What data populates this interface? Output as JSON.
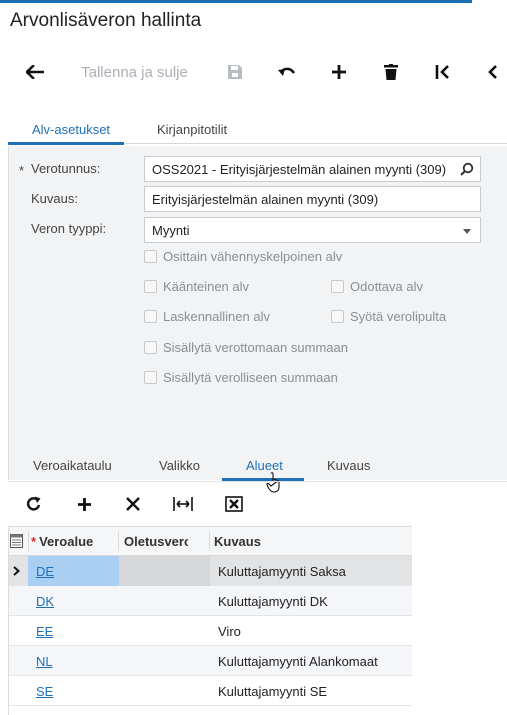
{
  "window": {
    "title": "Arvonlisäveron hallinta"
  },
  "toolbar": {
    "save_close_label": "Tallenna ja sulje"
  },
  "form_tabs": [
    {
      "label": "Alv-asetukset",
      "active": true
    },
    {
      "label": "Kirjanpitotilit",
      "active": false
    }
  ],
  "form": {
    "required_mark": "*",
    "tax_id": {
      "label": "Verotunnus:",
      "value": "OSS2021 - Erityisjärjestelmän alainen myynti (309)"
    },
    "description": {
      "label": "Kuvaus:",
      "value": "Erityisjärjestelmän alainen myynti (309)"
    },
    "tax_type": {
      "label": "Veron tyyppi:",
      "value": "Myynti"
    },
    "checkboxes": {
      "partial_deductible": {
        "label": "Osittain vähennyskelpoinen alv",
        "checked": false
      },
      "reverse": {
        "label": "Käänteinen alv",
        "checked": false
      },
      "pending": {
        "label": "Odottava alv",
        "checked": false
      },
      "calculated": {
        "label": "Laskennallinen alv",
        "checked": false
      },
      "enter_tax_slip": {
        "label": "Syötä verolipulta",
        "checked": false
      },
      "include_untaxed": {
        "label": "Sisällytä verottomaan summaan",
        "checked": false
      },
      "include_taxed": {
        "label": "Sisällytä verolliseen summaan",
        "checked": false
      }
    }
  },
  "grid_tabs": [
    {
      "label": "Veroaikataulu",
      "active": false
    },
    {
      "label": "Valikko",
      "active": false
    },
    {
      "label": "Alueet",
      "active": true
    },
    {
      "label": "Kuvaus",
      "active": false
    }
  ],
  "grid": {
    "required_mark": "*",
    "columns": [
      "Veroalue",
      "Oletusvero",
      "Kuvaus"
    ],
    "rows": [
      {
        "code": "DE",
        "default": "",
        "description": "Kuluttajamyynti Saksa",
        "selected": true
      },
      {
        "code": "DK",
        "default": "",
        "description": "Kuluttajamyynti DK",
        "selected": false
      },
      {
        "code": "EE",
        "default": "",
        "description": "Viro",
        "selected": false
      },
      {
        "code": "NL",
        "default": "",
        "description": "Kuluttajamyynti Alankomaat",
        "selected": false
      },
      {
        "code": "SE",
        "default": "",
        "description": "Kuluttajamyynti SE",
        "selected": false
      }
    ]
  },
  "colors": {
    "accent": "#1f6fb8",
    "selected_cell": "#a9d0f2",
    "selected_row": "#e2e3e5",
    "form_bg": "#f2f3f4"
  }
}
